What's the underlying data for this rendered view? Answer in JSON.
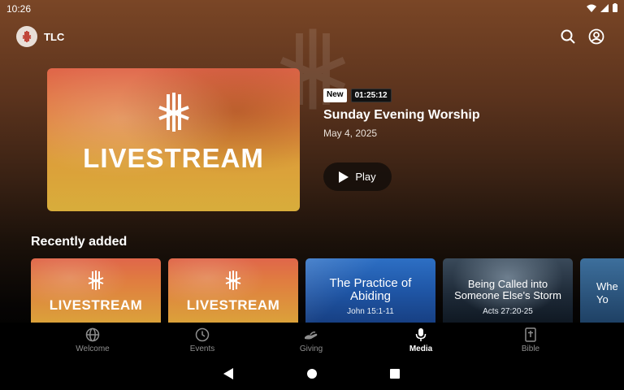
{
  "status_bar": {
    "time": "10:26"
  },
  "app": {
    "name": "TLC"
  },
  "hero": {
    "thumbnail_text": "LIVESTREAM",
    "badge_new": "New",
    "duration": "01:25:12",
    "title": "Sunday Evening Worship",
    "date": "May 4, 2025",
    "play_label": "Play"
  },
  "recently_added": {
    "title": "Recently added",
    "items": [
      {
        "kind": "livestream",
        "text": "LIVESTREAM"
      },
      {
        "kind": "livestream",
        "text": "LIVESTREAM"
      },
      {
        "kind": "sermon",
        "title": "The Practice of Abiding",
        "reference": "John 15:1-11"
      },
      {
        "kind": "sermon",
        "title": "Being Called into Someone Else's Storm",
        "reference": "Acts 27:20-25"
      },
      {
        "kind": "partial",
        "title": "Whe Yo"
      }
    ]
  },
  "bottom_nav": {
    "items": [
      {
        "label": "Welcome",
        "icon": "globe-icon"
      },
      {
        "label": "Events",
        "icon": "clock-icon"
      },
      {
        "label": "Giving",
        "icon": "giving-hand-icon"
      },
      {
        "label": "Media",
        "icon": "microphone-icon",
        "active": true
      },
      {
        "label": "Bible",
        "icon": "bible-icon"
      }
    ]
  },
  "colors": {
    "accent_orange": "#e07d40",
    "accent_gold": "#d8ad3b",
    "header_brown": "#7a4626",
    "nav_inactive": "#8e8e8e"
  }
}
